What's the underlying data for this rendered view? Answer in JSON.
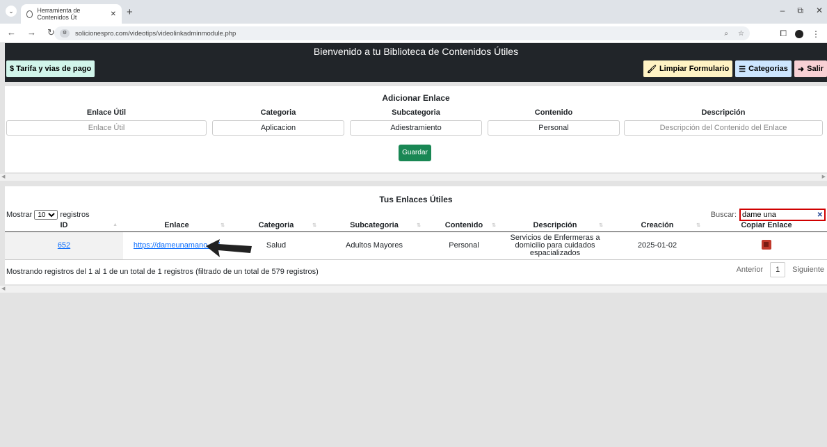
{
  "browser": {
    "tab_title": "Herramienta de Contenidos Út",
    "url": "solicionespro.com/videotips/videolinkadminmodule.php"
  },
  "header": {
    "title": "Bienvenido a tu Biblioteca de Contenidos Útiles",
    "tarifa_label": "$ Tarifa y vias de pago",
    "limpiar_label": "Limpiar Formulario",
    "categorias_label": "Categorias",
    "salir_label": "Salir"
  },
  "form": {
    "title": "Adicionar Enlace",
    "fields": [
      {
        "label": "Enlace Útil",
        "value": "",
        "placeholder": "Enlace Útil"
      },
      {
        "label": "Categoria",
        "value": "Aplicacion"
      },
      {
        "label": "Subcategoria",
        "value": "Adiestramiento"
      },
      {
        "label": "Contenido",
        "value": "Personal"
      },
      {
        "label": "Descripción",
        "value": "",
        "placeholder": "Descripción del Contenido del Enlace"
      }
    ],
    "save_label": "Guardar"
  },
  "table": {
    "title": "Tus Enlaces Útiles",
    "show_prefix": "Mostrar",
    "show_value": "10",
    "show_suffix": "registros",
    "search_label": "Buscar:",
    "search_value": "dame una",
    "columns": [
      "ID",
      "Enlace",
      "Categoria",
      "Subcategoria",
      "Contenido",
      "Descripción",
      "Creación",
      "Copiar Enlace"
    ],
    "rows": [
      {
        "id": "652",
        "link": "https://dameunamano.co/",
        "category": "Salud",
        "subcategory": "Adultos Mayores",
        "content": "Personal",
        "description": "Servicios de Enfermeras a domicilio para cuidados espacializados",
        "created": "2025-01-02"
      }
    ],
    "info": "Mostrando registros del 1 al 1 de un total de 1 registros (filtrado de un total de 579 registros)",
    "prev_label": "Anterior",
    "page": "1",
    "next_label": "Siguiente"
  }
}
